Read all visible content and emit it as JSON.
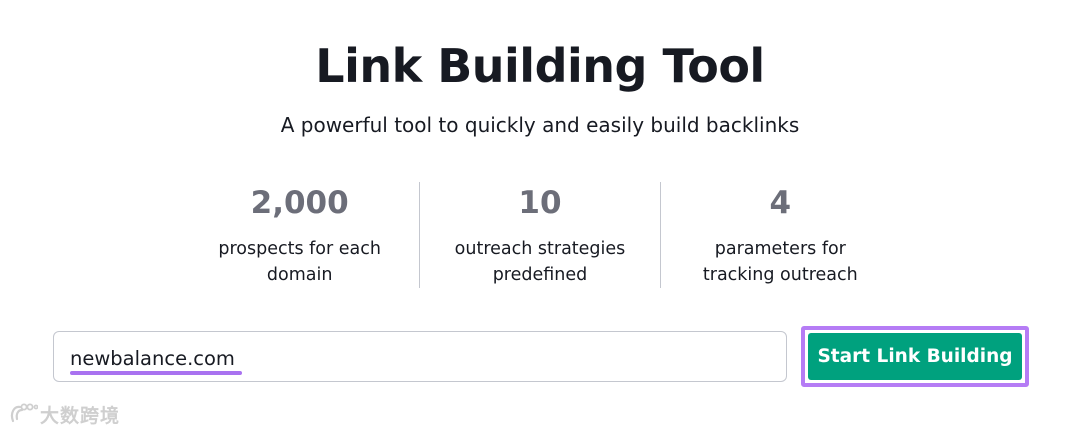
{
  "header": {
    "title": "Link Building Tool",
    "subtitle": "A powerful tool to quickly and easily build backlinks"
  },
  "stats": [
    {
      "value": "2,000",
      "label_line1": "prospects for each",
      "label_line2": "domain"
    },
    {
      "value": "10",
      "label_line1": "outreach strategies",
      "label_line2": "predefined"
    },
    {
      "value": "4",
      "label_line1": "parameters for",
      "label_line2": "tracking outreach"
    }
  ],
  "search": {
    "value": "newbalance.com",
    "placeholder": ""
  },
  "actions": {
    "start_label": "Start Link Building"
  },
  "watermark": {
    "text": "大数跨境",
    "icon": "logo-icon"
  },
  "colors": {
    "accent_button": "#00a17e",
    "highlight_purple": "#b57cf5",
    "stat_value": "#6c6e79"
  }
}
